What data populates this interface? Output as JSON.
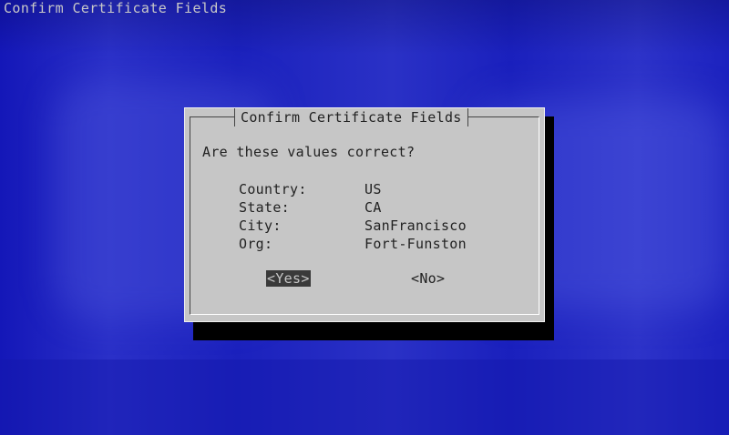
{
  "screen": {
    "title": "Confirm Certificate Fields",
    "background_color": "#1a1fbf"
  },
  "dialog": {
    "title": "Confirm Certificate Fields",
    "prompt": "Are these values correct?",
    "fields": [
      {
        "label": "Country:",
        "value": "US"
      },
      {
        "label": "State:",
        "value": "CA"
      },
      {
        "label": "City:",
        "value": "SanFrancisco"
      },
      {
        "label": "Org:",
        "value": "Fort-Funston"
      }
    ],
    "buttons": {
      "yes_label": "<Yes>",
      "no_label": "<No>",
      "selected": "yes"
    },
    "colors": {
      "face": "#c6c6c6",
      "shadow": "#000000",
      "selected_button_bg": "#3a3a3a"
    }
  }
}
